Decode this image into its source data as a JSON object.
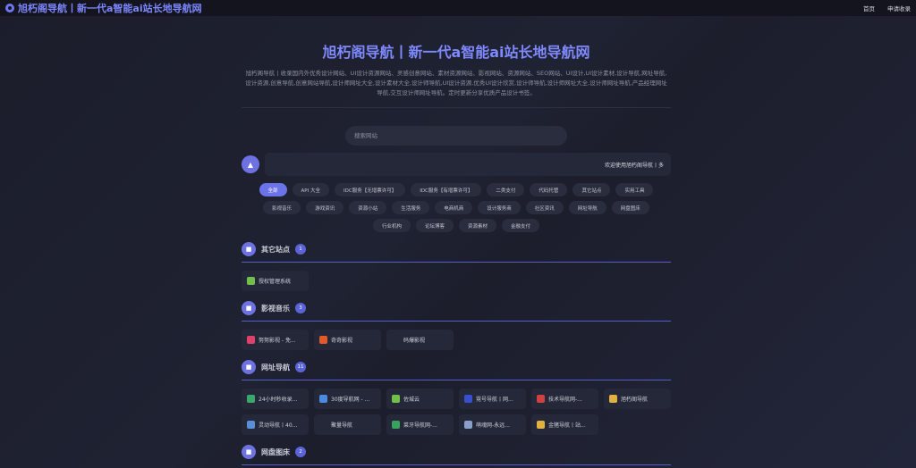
{
  "header": {
    "title": "旭朽阁导航丨新一代a智能ai站长地导航网",
    "nav": [
      "首页",
      "申请收录"
    ]
  },
  "hero": {
    "title": "旭朽阁导航丨新一代a智能ai站长地导航网",
    "desc": "旭朽阁导航丨收录国内外优秀设计网站、UI设计资源网站、灵感创意网站、素材资源网站、影视网站、资源网站、SEO网站、UI设计,UI设计素材,设计导航,网址导航,设计资源,创意导航,创意网站导航,设计师网址大全,设计素材大全,设计师导航,UI设计资源,优秀UI设计欣赏,设计师导航,设计师网址大全,设计师网址导航,产品经理网址导航,交互设计师网址导航。定时更新分享优质产品设计书签。"
  },
  "search": {
    "placeholder": "搜索网站"
  },
  "notice": {
    "text": "欢迎使用旭朽阁导航丨多"
  },
  "categories": [
    "全部",
    "API 大全",
    "IDC服务【无增票许可】",
    "IDC服务【有增票许可】",
    "二类支付",
    "代码托管",
    "其它站点",
    "实用工具",
    "影视音乐",
    "游戏资讯",
    "资源小站",
    "生活服务",
    "电商机商",
    "设计服务商",
    "社区资讯",
    "网址导航",
    "网盘图床",
    "行业机构",
    "论坛博客",
    "资源素材",
    "金融支付"
  ],
  "sections": [
    {
      "title": "其它站点",
      "count": "1",
      "items": [
        {
          "label": "授权管理系统",
          "color": "#6fbf4a"
        }
      ]
    },
    {
      "title": "影视音乐",
      "count": "3",
      "items": [
        {
          "label": "努努影视 - 免...",
          "color": "#e0406a"
        },
        {
          "label": "奇奇影视",
          "color": "#e05a2a"
        },
        {
          "label": "码爆影视",
          "color": ""
        }
      ]
    },
    {
      "title": "网址导航",
      "count": "11",
      "items": [
        {
          "label": "24小时秒收录...",
          "color": "#3aa86b"
        },
        {
          "label": "30度导航网 - ...",
          "color": "#4a8ae0"
        },
        {
          "label": "佐城云",
          "color": "#6fbf4a"
        },
        {
          "label": "霓号导航丨网...",
          "color": "#3a4fd0"
        },
        {
          "label": "技术导航网-...",
          "color": "#d04040"
        },
        {
          "label": "旭朽阁导航",
          "color": "#e0b040"
        },
        {
          "label": "灵动导航丨40...",
          "color": "#5a8fd8"
        },
        {
          "label": "聚量导航",
          "color": ""
        },
        {
          "label": "菜牙导航网-...",
          "color": "#3aa060"
        },
        {
          "label": "萌魂网-永远...",
          "color": "#8aa0c8"
        },
        {
          "label": "金猪导航丨站...",
          "color": "#e0b040"
        }
      ]
    },
    {
      "title": "网盘图床",
      "count": "2",
      "items": []
    }
  ]
}
